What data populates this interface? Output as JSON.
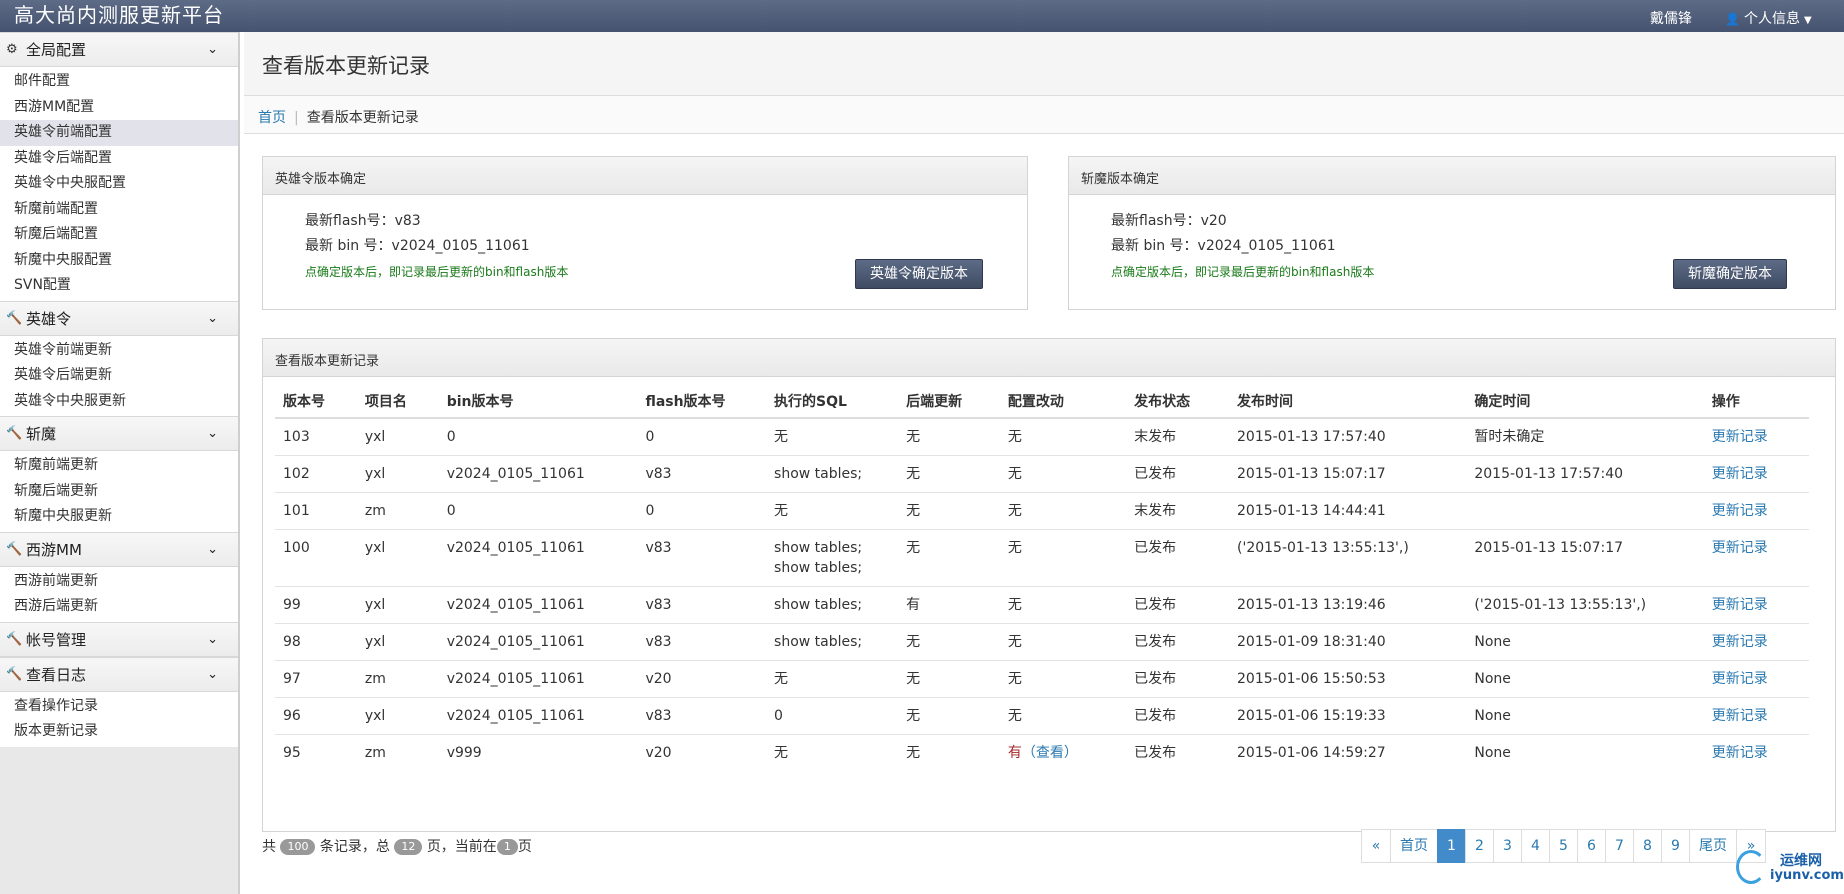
{
  "app_title": "高大尚内测服更新平台",
  "top_user": "戴儒锋",
  "top_menu_label": "个人信息",
  "sidebar": {
    "groups": [
      {
        "title": "全局配置",
        "icon": "dashboard-icon",
        "items": [
          "邮件配置",
          "西游MM配置",
          "英雄令前端配置",
          "英雄令后端配置",
          "英雄令中央服配置",
          "斩魔前端配置",
          "斩魔后端配置",
          "斩魔中央服配置",
          "SVN配置"
        ],
        "active": 2
      },
      {
        "title": "英雄令",
        "icon": "hammer-icon",
        "items": [
          "英雄令前端更新",
          "英雄令后端更新",
          "英雄令中央服更新"
        ]
      },
      {
        "title": "斩魔",
        "icon": "hammer-icon",
        "items": [
          "斩魔前端更新",
          "斩魔后端更新",
          "斩魔中央服更新"
        ]
      },
      {
        "title": "西游MM",
        "icon": "hammer-icon",
        "items": [
          "西游前端更新",
          "西游后端更新"
        ]
      },
      {
        "title": "帐号管理",
        "icon": "hammer-icon",
        "items": []
      },
      {
        "title": "查看日志",
        "icon": "hammer-icon",
        "items": [
          "查看操作记录",
          "版本更新记录"
        ]
      }
    ]
  },
  "page": {
    "title": "查看版本更新记录",
    "breadcrumb_home": "首页",
    "breadcrumb_current": "查看版本更新记录"
  },
  "yxl_panel": {
    "title": "英雄令版本确定",
    "flash_line": "最新flash号：v83",
    "bin_line": "最新 bin 号：v2024_0105_11061",
    "note": "点确定版本后，即记录最后更新的bin和flash版本",
    "button": "英雄令确定版本"
  },
  "zm_panel": {
    "title": "斩魔版本确定",
    "flash_line": "最新flash号：v20",
    "bin_line": "最新 bin 号：v2024_0105_11061",
    "note": "点确定版本后，即记录最后更新的bin和flash版本",
    "button": "斩魔确定版本"
  },
  "records": {
    "title": "查看版本更新记录",
    "columns": [
      "版本号",
      "项目名",
      "bin版本号",
      "flash版本号",
      "执行的SQL",
      "后端更新",
      "配置改动",
      "发布状态",
      "发布时间",
      "确定时间",
      "操作"
    ],
    "rows": [
      {
        "ver": "103",
        "proj": "yxl",
        "bin": "0",
        "flash": "0",
        "sql": "无",
        "backend": "无",
        "config": "无",
        "status": "末发布",
        "pub": "2015-01-13 17:57:40",
        "confirm": "暂时未确定",
        "op": "更新记录"
      },
      {
        "ver": "102",
        "proj": "yxl",
        "bin": "v2024_0105_11061",
        "flash": "v83",
        "sql": "show tables;",
        "backend": "无",
        "config": "无",
        "status": "已发布",
        "pub": "2015-01-13 15:07:17",
        "confirm": "2015-01-13 17:57:40",
        "op": "更新记录"
      },
      {
        "ver": "101",
        "proj": "zm",
        "bin": "0",
        "flash": "0",
        "sql": "无",
        "backend": "无",
        "config": "无",
        "status": "末发布",
        "pub": "2015-01-13 14:44:41",
        "confirm": "",
        "op": "更新记录"
      },
      {
        "ver": "100",
        "proj": "yxl",
        "bin": "v2024_0105_11061",
        "flash": "v83",
        "sql": "show tables;",
        "sql2": "show tables;",
        "backend": "无",
        "config": "无",
        "status": "已发布",
        "pub": "('2015-01-13 13:55:13',)",
        "confirm": "2015-01-13 15:07:17",
        "op": "更新记录"
      },
      {
        "ver": "99",
        "proj": "yxl",
        "bin": "v2024_0105_11061",
        "flash": "v83",
        "sql": "show tables;",
        "backend": "有",
        "config": "无",
        "status": "已发布",
        "pub": "2015-01-13 13:19:46",
        "confirm": "('2015-01-13 13:55:13',)",
        "op": "更新记录"
      },
      {
        "ver": "98",
        "proj": "yxl",
        "bin": "v2024_0105_11061",
        "flash": "v83",
        "sql": "show tables;",
        "backend": "无",
        "config": "无",
        "status": "已发布",
        "pub": "2015-01-09 18:31:40",
        "confirm": "None",
        "op": "更新记录"
      },
      {
        "ver": "97",
        "proj": "zm",
        "bin": "v2024_0105_11061",
        "flash": "v20",
        "sql": "无",
        "backend": "无",
        "config": "无",
        "status": "已发布",
        "pub": "2015-01-06 15:50:53",
        "confirm": "None",
        "op": "更新记录"
      },
      {
        "ver": "96",
        "proj": "yxl",
        "bin": "v2024_0105_11061",
        "flash": "v83",
        "sql": "0",
        "backend": "无",
        "config": "无",
        "status": "已发布",
        "pub": "2015-01-06 15:19:33",
        "confirm": "None",
        "op": "更新记录"
      },
      {
        "ver": "95",
        "proj": "zm",
        "bin": "v999",
        "flash": "v20",
        "sql": "无",
        "backend": "无",
        "config": "有",
        "config_link": "（查看）",
        "status": "已发布",
        "pub": "2015-01-06 14:59:27",
        "confirm": "None",
        "op": "更新记录"
      }
    ]
  },
  "pager": {
    "prefix": "共",
    "total": "100",
    "mid1": "条记录，总",
    "pages": "12",
    "mid2": "页，当前在",
    "current": "1",
    "suffix": "页",
    "prev": "«",
    "first": "首页",
    "numbers": [
      "1",
      "2",
      "3",
      "4",
      "5",
      "6",
      "7",
      "8",
      "9"
    ],
    "last": "尾页",
    "next": "»"
  },
  "watermark": {
    "cn": "运维网",
    "en": "iyunv.com"
  },
  "colors": {
    "topbar": "#4e5b78",
    "link": "#2a7ab0",
    "not_published": "#a52a2a",
    "note_green": "#1a7a1a",
    "page_active": "#428bca"
  }
}
